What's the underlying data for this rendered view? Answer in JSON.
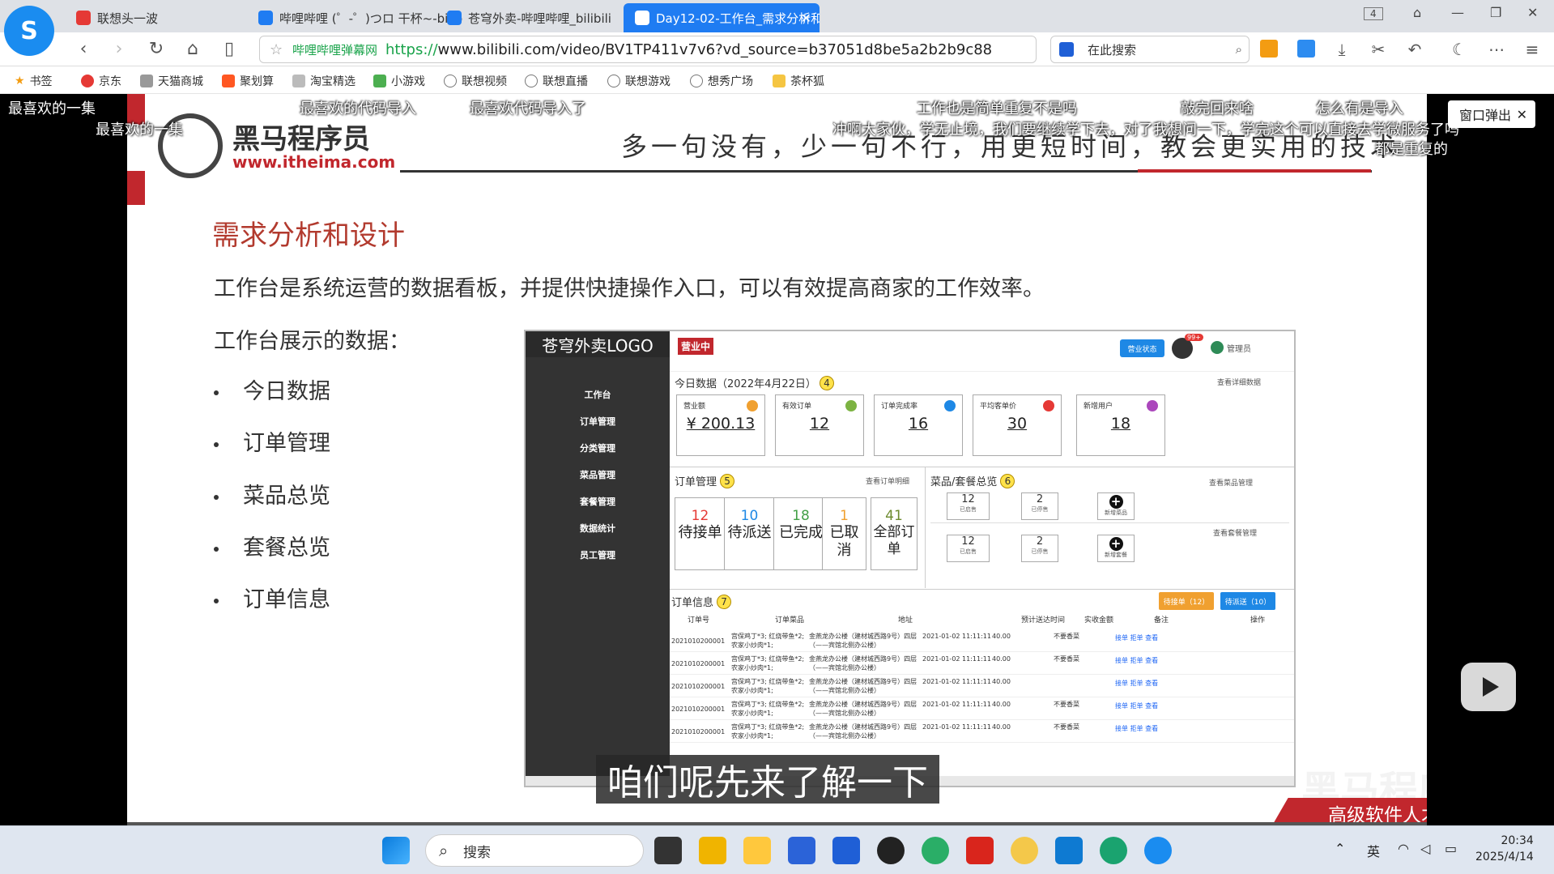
{
  "browser": {
    "tabs": [
      {
        "title": "联想头一波",
        "icon_color": "#e53935"
      },
      {
        "title": "哔哩哔哩 (゜-゜)つロ 干杯~-bilib",
        "icon_color": "#1f7cf2"
      },
      {
        "title": "苍穹外卖-哔哩哔哩_bilibili",
        "icon_color": "#1f7cf2"
      },
      {
        "title": "Day12-02-工作台_需求分析和",
        "icon_color": "#ffffff",
        "active": true
      }
    ],
    "tab_count": "4",
    "url_site_label": "哔哩哔哩弹幕网",
    "url_protocol": "https://",
    "url_rest": "www.bilibili.com/video/BV1TP411v7v6?vd_source=b37051d8be5a2b2b9c88",
    "search_placeholder": "在此搜索",
    "bookmarks": [
      "书签",
      "京东",
      "天猫商城",
      "聚划算",
      "淘宝精选",
      "小游戏",
      "联想视频",
      "联想直播",
      "联想游戏",
      "想秀广场",
      "茶杯狐"
    ]
  },
  "danmaku": [
    "最喜欢的一集",
    "最喜欢的代码导入",
    "最喜欢代码导入了",
    "工作也是简单重复不是吗",
    "敲完回来啥",
    "怎么有是导入",
    "最喜欢的一集",
    "冲啊大家伙，学无止境，我们要继续学下去，对了我想问一下，学完这个可以直接去学微服务了吗",
    "都是重复的"
  ],
  "popout_button": "窗口弹出",
  "slide": {
    "brand_name": "黑马程序员",
    "brand_url": "www.itheima.com",
    "slogan": "多一句没有，少一句不行，用更短时间，教会更实用的技术",
    "section_title": "需求分析和设计",
    "intro": "工作台是系统运营的数据看板，并提供快捷操作入口，可以有效提高商家的工作效率。",
    "subhead": "工作台展示的数据：",
    "bullets": [
      "今日数据",
      "订单管理",
      "菜品总览",
      "套餐总览",
      "订单信息"
    ],
    "footer_text": "高级软件人才培训专家",
    "watermark": "黑马程序员 bilibili"
  },
  "mockup": {
    "brand": "苍穹外卖LOGO",
    "status_ribbon": "营业中",
    "status_button": "营业状态",
    "msg_badge": "99+",
    "admin": "管理员",
    "menu": [
      "工作台",
      "订单管理",
      "分类管理",
      "菜品管理",
      "套餐管理",
      "数据统计",
      "员工管理"
    ],
    "today_title": "今日数据（2022年4月22日）",
    "today_badge": "4",
    "today_link": "查看详细数据",
    "kpis": [
      {
        "label": "营业额",
        "value": "¥ 200.13",
        "color": "#f0a030"
      },
      {
        "label": "有效订单",
        "value": "12",
        "color": "#7cb342"
      },
      {
        "label": "订单完成率",
        "value": "16",
        "color": "#1e88e5"
      },
      {
        "label": "平均客单价",
        "value": "30",
        "color": "#e53935"
      },
      {
        "label": "新增用户",
        "value": "18",
        "color": "#ab47bc"
      }
    ],
    "orders_title": "订单管理",
    "orders_badge": "5",
    "orders_link": "查看订单明细",
    "orders": [
      {
        "num": "12",
        "label": "待接单",
        "color": "#e53935"
      },
      {
        "num": "10",
        "label": "待派送",
        "color": "#1e88e5"
      },
      {
        "num": "18",
        "label": "已完成",
        "color": "#43a047"
      },
      {
        "num": "1",
        "label": "已取消",
        "color": "#f0a030"
      },
      {
        "num": "41",
        "label": "全部订单",
        "color": "#6d8b2f"
      }
    ],
    "dish_title": "菜品/套餐总览",
    "dish_badge": "6",
    "dish_link": "查看菜品管理",
    "setmeal_link": "查看套餐管理",
    "dish_row": [
      {
        "num": "12",
        "label": "已启售"
      },
      {
        "num": "2",
        "label": "已停售"
      }
    ],
    "setmeal_row": [
      {
        "num": "12",
        "label": "已启售"
      },
      {
        "num": "2",
        "label": "已停售"
      }
    ],
    "add_dish": "新增菜品",
    "add_setmeal": "新增套餐",
    "info_title": "订单信息",
    "info_badge": "7",
    "chip_pending": "待接单（12）",
    "chip_deliver": "待派送（10）",
    "table_headers": [
      "订单号",
      "订单菜品",
      "地址",
      "预计送达时间",
      "实收金额",
      "备注",
      "操作"
    ],
    "rows": [
      {
        "id": "2021010200001",
        "items": "宫保鸡丁*3; 红烧带鱼*2; 农家小炒肉*1;",
        "addr": "金燕龙办公楼（建材城西路9号）四层（——宾馆北侧办公楼）",
        "time": "2021-01-02 11:11:11",
        "amount": "40.00",
        "note": "不要香菜",
        "ops": "接单  拒单  查看"
      },
      {
        "id": "2021010200001",
        "items": "宫保鸡丁*3; 红烧带鱼*2; 农家小炒肉*1;",
        "addr": "金燕龙办公楼（建材城西路9号）四层（——宾馆北侧办公楼）",
        "time": "2021-01-02 11:11:11",
        "amount": "40.00",
        "note": "不要香菜",
        "ops": "接单  拒单  查看"
      },
      {
        "id": "2021010200001",
        "items": "宫保鸡丁*3; 红烧带鱼*2; 农家小炒肉*1;",
        "addr": "金燕龙办公楼（建材城西路9号）四层（——宾馆北侧办公楼）",
        "time": "2021-01-02 11:11:11",
        "amount": "40.00",
        "note": "",
        "ops": "接单  拒单  查看"
      },
      {
        "id": "2021010200001",
        "items": "宫保鸡丁*3; 红烧带鱼*2; 农家小炒肉*1;",
        "addr": "金燕龙办公楼（建材城西路9号）四层（——宾馆北侧办公楼）",
        "time": "2021-01-02 11:11:11",
        "amount": "40.00",
        "note": "不要香菜",
        "ops": "接单  拒单  查看"
      },
      {
        "id": "2021010200001",
        "items": "宫保鸡丁*3; 红烧带鱼*2; 农家小炒肉*1;",
        "addr": "金燕龙办公楼（建材城西路9号）四层（——宾馆北侧办公楼）",
        "time": "2021-01-02 11:11:11",
        "amount": "40.00",
        "note": "不要香菜",
        "ops": "接单  拒单  查看"
      }
    ]
  },
  "video_subtitle": "咱们呢先来了解一下",
  "taskbar": {
    "search_placeholder": "搜索",
    "ime": "英",
    "time": "20:34",
    "date": "2025/4/14"
  }
}
